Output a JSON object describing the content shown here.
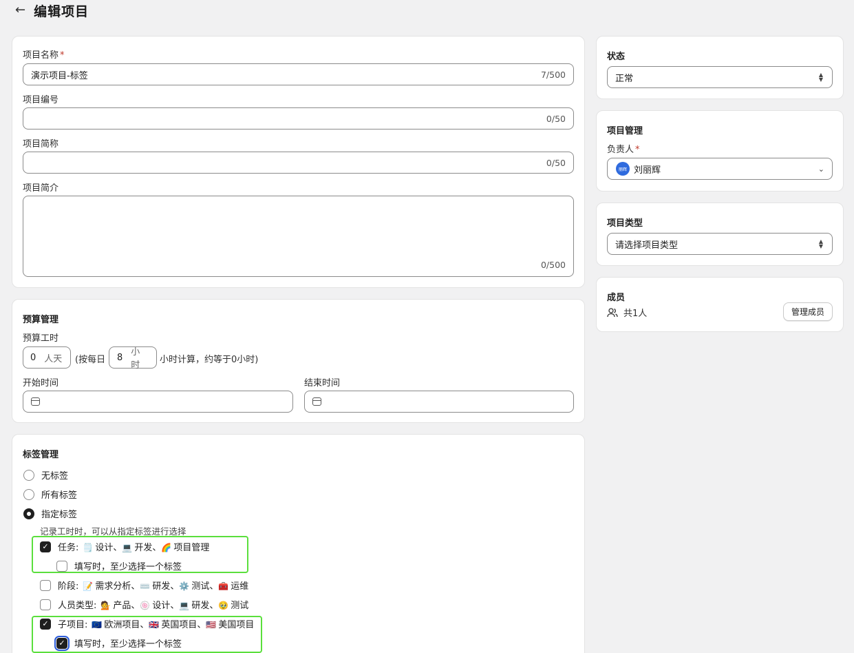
{
  "header": {
    "back_icon": "arrow-left-icon",
    "title": "编辑项目"
  },
  "info": {
    "name_label": "项目名称",
    "required": "*",
    "name_value": "演示项目-标签",
    "name_count": "7/500",
    "code_label": "项目编号",
    "code_count": "0/50",
    "short_label": "项目简称",
    "short_count": "0/50",
    "desc_label": "项目简介",
    "desc_count": "0/500"
  },
  "budget": {
    "title": "预算管理",
    "hours_label": "预算工时",
    "days_value": "0",
    "days_unit": "人天",
    "per_day_prefix": "(按每日",
    "hours_value": "8",
    "hours_unit": "小时",
    "suffix": "小时计算，约等于0小时)",
    "start_label": "开始时间",
    "end_label": "结束时间"
  },
  "tags": {
    "title": "标签管理",
    "radio_none": "无标签",
    "radio_all": "所有标签",
    "radio_specified": "指定标签",
    "hint": "记录工时时，可以从指定标签进行选择",
    "groups": [
      {
        "prefix": "任务:",
        "items": [
          {
            "emoji": "🗒️",
            "text": "设计"
          },
          {
            "emoji": "💻",
            "text": "开发"
          },
          {
            "emoji": "🌈",
            "text": "项目管理"
          }
        ],
        "checked": true,
        "sub_label": "填写时，至少选择一个标签",
        "sub_checked": false
      },
      {
        "prefix": "阶段:",
        "items": [
          {
            "emoji": "📝",
            "text": "需求分析"
          },
          {
            "emoji": "⌨️",
            "text": "研发"
          },
          {
            "emoji": "⚙️",
            "text": "测试"
          },
          {
            "emoji": "🧰",
            "text": "运维"
          }
        ],
        "checked": false
      },
      {
        "prefix": "人员类型:",
        "items": [
          {
            "emoji": "💁",
            "text": "产品"
          },
          {
            "emoji": "🍥",
            "text": "设计"
          },
          {
            "emoji": "💻",
            "text": "研发"
          },
          {
            "emoji": "🥹",
            "text": "测试"
          }
        ],
        "checked": false
      },
      {
        "prefix": "子项目:",
        "items": [
          {
            "emoji": "🇪🇺",
            "text": "欧洲项目"
          },
          {
            "emoji": "🇬🇧",
            "text": "英国项目"
          },
          {
            "emoji": "🇺🇸",
            "text": "美国项目"
          }
        ],
        "checked": true,
        "sub_label": "填写时，至少选择一个标签",
        "sub_checked": true
      }
    ],
    "separator": "、"
  },
  "status": {
    "title": "状态",
    "value": "正常"
  },
  "management": {
    "title": "项目管理",
    "owner_label": "负责人",
    "required": "*",
    "avatar_text": "丽辉",
    "owner_value": "刘丽辉"
  },
  "type": {
    "title": "项目类型",
    "placeholder": "请选择项目类型"
  },
  "members": {
    "title": "成员",
    "count": "共1人",
    "manage_button": "管理成员"
  },
  "colors": {
    "accent": "#2f6bde",
    "highlight": "#5adf3c",
    "required": "#c0392b"
  }
}
